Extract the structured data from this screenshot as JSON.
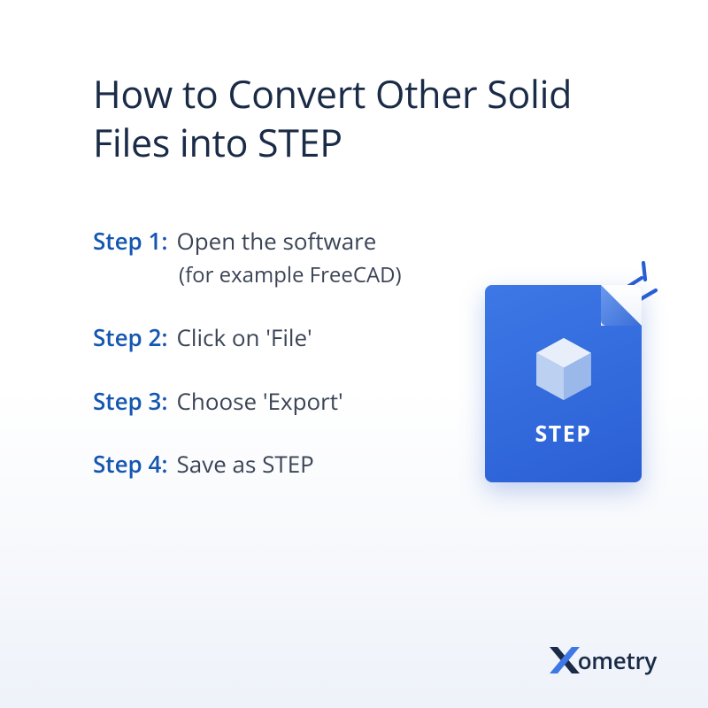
{
  "title": "How to Convert Other Solid Files into STEP",
  "steps": [
    {
      "label": "Step 1:",
      "text": "Open the software",
      "sub": "(for example FreeCAD)"
    },
    {
      "label": "Step 2:",
      "text": "Click on 'File'"
    },
    {
      "label": "Step 3:",
      "text": "Choose 'Export'"
    },
    {
      "label": "Step 4:",
      "text": "Save as STEP"
    }
  ],
  "file": {
    "label": "STEP"
  },
  "brand": {
    "name": "ometry"
  },
  "colors": {
    "accent": "#1557b0",
    "text_dark": "#1a2b47",
    "text_body": "#3b4456",
    "file_bg": "#2a5fd4"
  }
}
